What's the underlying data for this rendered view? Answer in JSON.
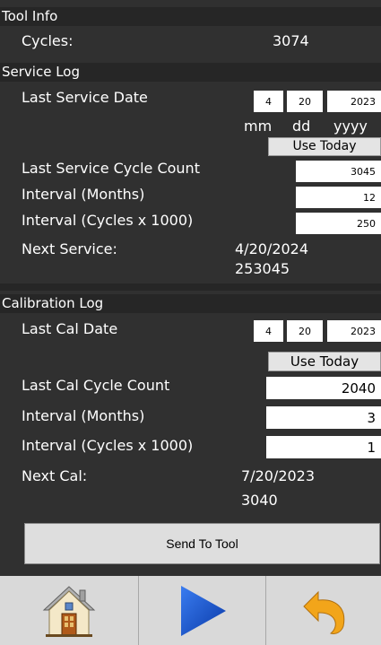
{
  "tool_info": {
    "header": "Tool Info",
    "cycles_label": "Cycles:",
    "cycles_value": "3074"
  },
  "service_log": {
    "header": "Service Log",
    "last_service_date_label": "Last Service Date",
    "date": {
      "mm": "4",
      "dd": "20",
      "yyyy": "2023"
    },
    "date_labels": {
      "mm": "mm",
      "dd": "dd",
      "yyyy": "yyyy"
    },
    "use_today": "Use Today",
    "last_cycle_count_label": "Last Service Cycle Count",
    "last_cycle_count": "3045",
    "interval_months_label": "Interval (Months)",
    "interval_months": "12",
    "interval_cycles_label": "Interval (Cycles x 1000)",
    "interval_cycles": "250",
    "next_label": "Next Service:",
    "next_date": "4/20/2024",
    "next_cycles": "253045"
  },
  "calibration_log": {
    "header": "Calibration Log",
    "last_cal_date_label": "Last Cal Date",
    "date": {
      "mm": "4",
      "dd": "20",
      "yyyy": "2023"
    },
    "use_today": "Use Today",
    "last_cycle_count_label": "Last Cal Cycle Count",
    "last_cycle_count": "2040",
    "interval_months_label": "Interval (Months)",
    "interval_months": "3",
    "interval_cycles_label": "Interval (Cycles x 1000)",
    "interval_cycles": "1",
    "next_label": "Next Cal:",
    "next_date": "7/20/2023",
    "next_cycles": "3040"
  },
  "actions": {
    "send_to_tool": "Send To Tool"
  },
  "footer": {
    "icons": [
      "home-icon",
      "play-icon",
      "undo-icon"
    ]
  },
  "colors": {
    "background": "#303030",
    "header": "#262626",
    "play_blue": "#1e5fd8",
    "undo_orange": "#f0a020"
  }
}
